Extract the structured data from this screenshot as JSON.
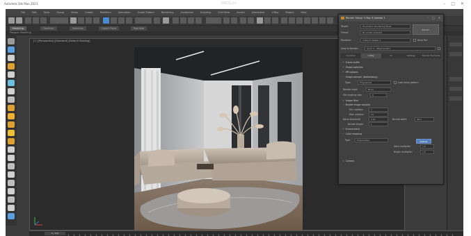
{
  "window": {
    "title": "Autodesk 3ds Max 2023",
    "watermark": "RRCG.cn",
    "controls": [
      "–",
      "□",
      "✕"
    ]
  },
  "menubar": [
    "File",
    "Edit",
    "Tools",
    "Group",
    "Views",
    "Create",
    "Modifiers",
    "Animation",
    "Graph Editors",
    "Rendering",
    "Customize",
    "Scripting",
    "Civil View",
    "Arnold",
    "Interactive",
    "V-Ray",
    "Project",
    "Help"
  ],
  "ribbon": {
    "tabs": [
      "Modeling",
      "Freeform",
      "Selection",
      "Object Paint",
      "Populate"
    ],
    "subtitle": "Polygon Modeling"
  },
  "viewport": {
    "label": "[+] [Perspective] [Standard] [Default Shading]"
  },
  "timeline": {
    "frame": "0 / 100"
  },
  "render_dialog": {
    "title": "Render Setup: V-Ray 6 Update 1",
    "controls": [
      "–",
      "□",
      "✕"
    ],
    "target_label": "Target:",
    "target_value": "Production Rendering Mode",
    "preset_label": "Preset:",
    "preset_value": "No preset selected",
    "renderer_label": "Renderer:",
    "renderer_value": "V-Ray 6 Update 1",
    "save_file_label": "Save File",
    "view_label": "View to Render:",
    "view_value": "Quad 4 - VRayCam001",
    "render_button": "Render",
    "tabs": [
      "Common",
      "V-Ray",
      "GI",
      "Settings",
      "Render Elements"
    ],
    "sections": {
      "frame_buffer": "Frame buffer",
      "global_switches": "Global switches",
      "ipr_options": "IPR options",
      "image_sampler": "Image sampler (Antialiasing)",
      "image_filter": "Image filter",
      "bucket_sampler": "Bucket image sampler",
      "environment": "Environment",
      "color_mapping": "Color mapping",
      "camera": "Camera"
    },
    "sampler": {
      "type_label": "Type:",
      "type_value": "Progressive",
      "lock_label": "Lock noise pattern",
      "render_mask_label": "Render mask",
      "render_mask_value": "None",
      "min_shading_label": "Min shading rate",
      "min_shading_value": "6"
    },
    "bucket": {
      "min_subdivs_label": "Min. subdivs",
      "min_subdivs_value": "1",
      "max_subdivs_label": "Max. subdivs",
      "max_subdivs_value": "24",
      "noise_label": "Noise threshold",
      "noise_value": "0.01",
      "bucket_width_label": "Bucket width",
      "bucket_width_value": "48.0",
      "bucket_height_label": "Bucket height",
      "bucket_height_value": "L"
    },
    "color_map": {
      "type_label": "Type",
      "type_value": "Exponential",
      "default_button": "Default",
      "dark_label": "Dark multiplier:",
      "dark_value": "1.0",
      "bright_label": "Bright multiplier:",
      "bright_value": "1.0"
    }
  }
}
